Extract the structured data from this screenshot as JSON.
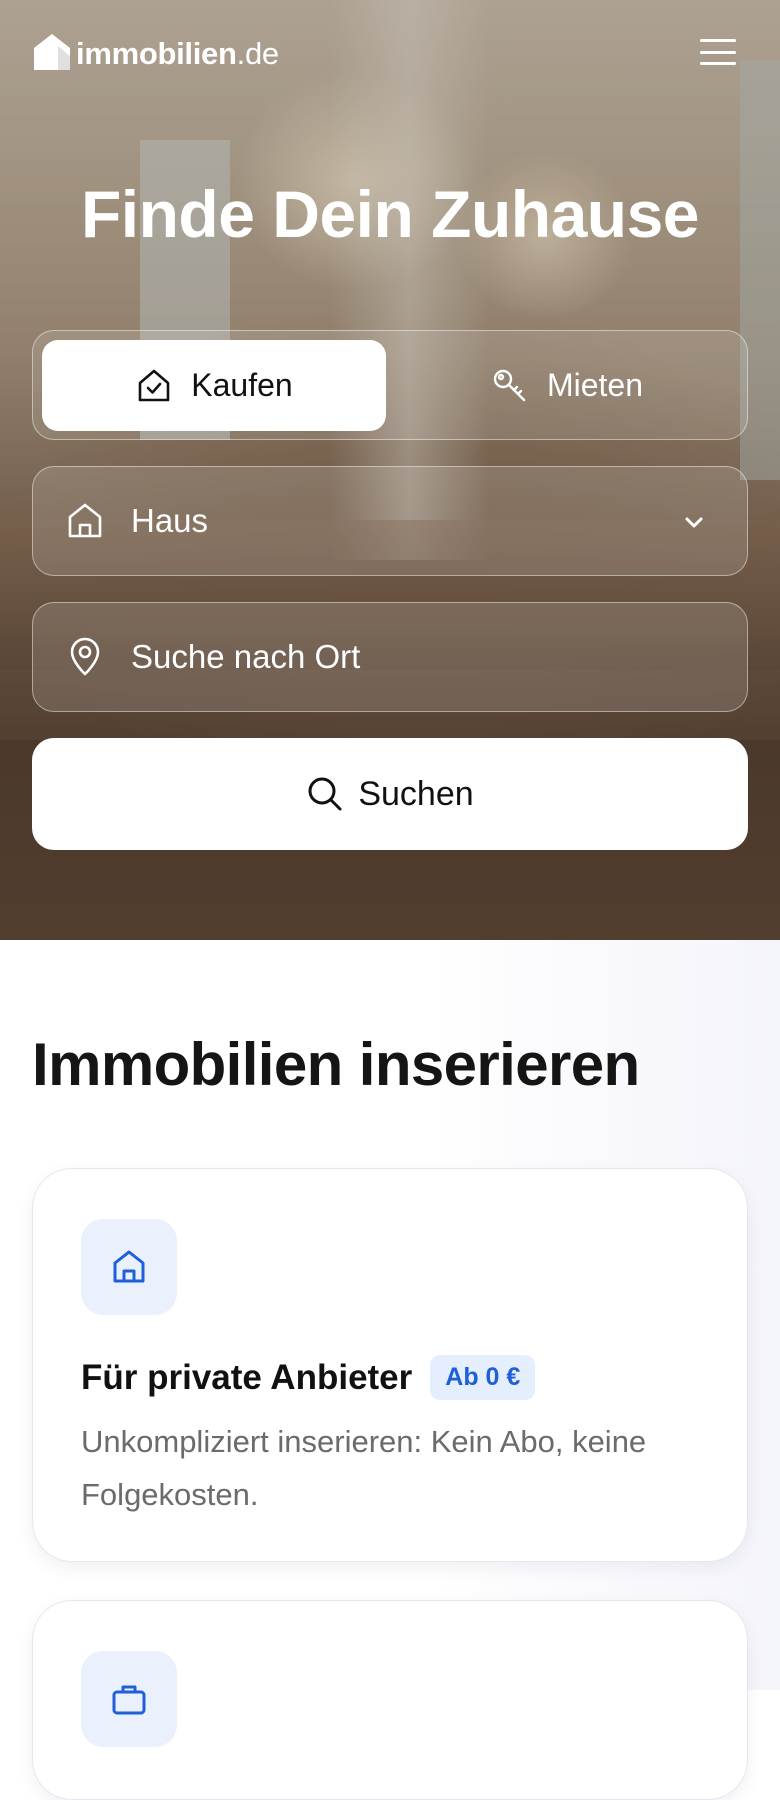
{
  "header": {
    "logo_text": "immobilien",
    "logo_suffix": ".de",
    "menu_icon": "hamburger-menu-icon"
  },
  "hero": {
    "title": "Finde Dein Zuhause",
    "tabs": [
      {
        "label": "Kaufen",
        "icon": "house-check-icon",
        "active": true
      },
      {
        "label": "Mieten",
        "icon": "key-icon",
        "active": false
      }
    ],
    "property_type": {
      "value": "Haus",
      "icon": "house-icon",
      "dropdown_icon": "chevron-down-icon"
    },
    "location": {
      "placeholder": "Suche nach Ort",
      "icon": "map-pin-icon"
    },
    "search_button": {
      "label": "Suchen",
      "icon": "search-icon"
    }
  },
  "list_section": {
    "title": "Immobilien inserieren",
    "cards": [
      {
        "icon": "house-icon",
        "title": "Für private Anbieter",
        "badge": "Ab 0 €",
        "description": "Unkompliziert inserieren: Kein Abo, keine Folgekosten."
      },
      {
        "icon": "briefcase-icon"
      }
    ]
  },
  "colors": {
    "accent_blue": "#1f5fd8",
    "icon_bg": "#eaf1fd",
    "badge_bg": "#e4eefd"
  }
}
